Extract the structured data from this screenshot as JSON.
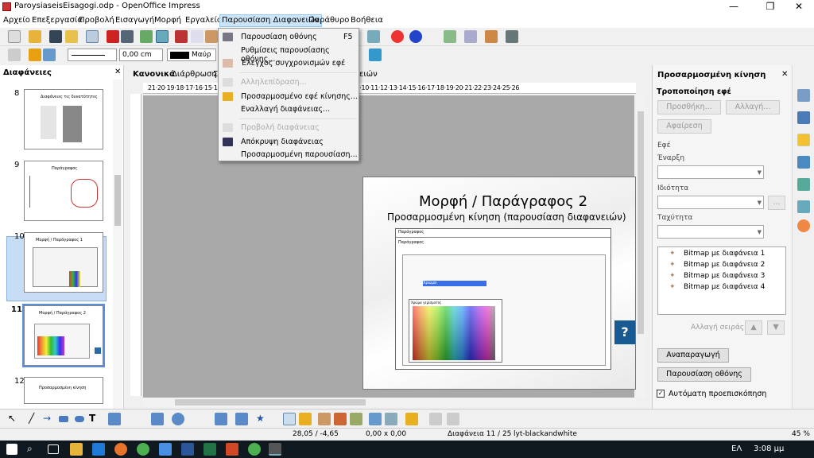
{
  "window": {
    "title": "ParoysiaseisEisagogi.odp - OpenOffice Impress",
    "minimize": "—",
    "maximize": "❐",
    "close": "✕"
  },
  "menu": [
    "Αρχείο",
    "Επεξεργασία",
    "Προβολή",
    "Εισαγωγή",
    "Μορφή",
    "Εργαλεία",
    "Παρουσίαση Διαφανειών",
    "Παράθυρο",
    "Βοήθεια"
  ],
  "toolbar2": {
    "line_width": "0,00 cm",
    "color_name": "Μαύρ"
  },
  "slides_pane": {
    "title": "Διαφάνειες",
    "close": "✕",
    "numbers": [
      "8",
      "9",
      "10",
      "11",
      "12"
    ],
    "thumb_titles": [
      "Διαφάνειες τις δυνατότητες",
      "Παράγραφος",
      "Μορφή / Παράγραφος 1",
      "Μορφή / Παράγραφος 2",
      "Προσαρμοσμένη κίνηση"
    ]
  },
  "view_tabs": {
    "normal": "Κανονικά",
    "outline": "Διάρθρωση",
    "hidden": "Σ",
    "tail": "ειών"
  },
  "hruler": "21·20·19·18·17·16·15·14·13·12·11·10·9·8·7·6·5·4·3·2·1·1·2·3·4·5·6·7·8·9·10·11·12·13·14·15·16·17·18·19·20·21·22·23·24·25·26",
  "slide": {
    "title": "Μορφή / Παράγραφος 2",
    "subtitle": "Προσαρμοσμένη κίνηση (παρουσίαση διαφανειών)",
    "dialog_title": "Παράγραφος",
    "dialog_title2": "Παράγραφος",
    "dialog_tab": "Χρώμα",
    "palette_label": "Χρώμα γεμίσματος",
    "help_glyph": "?"
  },
  "dropdown": {
    "items": [
      {
        "label": "Παρουσίαση οθόνης",
        "shortcut": "F5",
        "enabled": true
      },
      {
        "label": "Ρυθμίσεις παρουσίασης οθόνης...",
        "shortcut": "",
        "enabled": true
      },
      {
        "label": "Έλεγχος συγχρονισμών εφέ",
        "shortcut": "",
        "enabled": true
      },
      {
        "label": "Αλληλεπίδραση...",
        "shortcut": "",
        "enabled": false
      },
      {
        "label": "Προσαρμοσμένο εφέ κίνησης...",
        "shortcut": "",
        "enabled": true
      },
      {
        "label": "Εναλλαγή διαφάνειας...",
        "shortcut": "",
        "enabled": true
      },
      {
        "label": "Προβολή διαφάνειας",
        "shortcut": "",
        "enabled": false
      },
      {
        "label": "Απόκρυψη διαφάνειας",
        "shortcut": "",
        "enabled": true
      },
      {
        "label": "Προσαρμοσμένη παρουσίαση...",
        "shortcut": "",
        "enabled": true
      }
    ]
  },
  "right_pane": {
    "title": "Προσαρμοσμένη κίνηση",
    "close": "✕",
    "section": "Τροποποίηση εφέ",
    "add_btn": "Προσθήκη...",
    "change_btn": "Αλλαγή...",
    "remove_btn": "Αφαίρεση",
    "effect_label": "Εφέ",
    "start_label": "Έναρξη",
    "property_label": "Ιδιότητα",
    "speed_label": "Ταχύτητα",
    "more_btn": "...",
    "effects": [
      "Bitmap με διαφάνεια 1",
      "Bitmap με διαφάνεια 2",
      "Bitmap με διαφάνεια 3",
      "Bitmap με διαφάνεια 4"
    ],
    "order_label": "Αλλαγή σειράς:",
    "play_btn": "Αναπαραγωγή",
    "slideshow_btn": "Παρουσίαση οθόνης",
    "autopreview": "Αυτόματη προεπισκόπηση"
  },
  "status": {
    "position": "28,05 / -4,65",
    "size": "0,00 x 0,00",
    "slide": "Διαφάνεια 11 / 25",
    "layout": "lyt-blackandwhite",
    "zoom": "45 %"
  },
  "taskbar": {
    "lang": "ΕΛ",
    "time": "3:08 μμ"
  }
}
